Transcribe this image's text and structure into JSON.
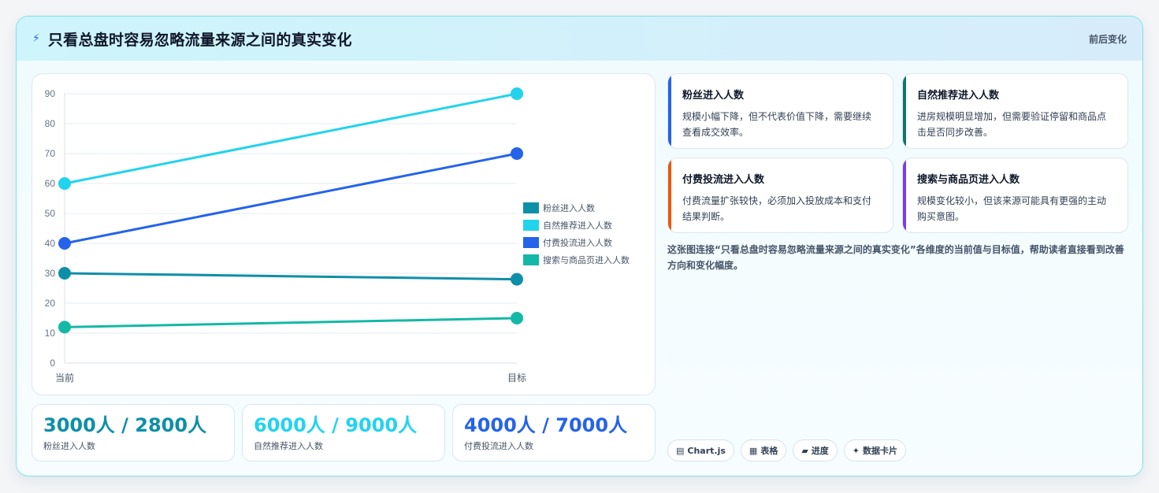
{
  "header": {
    "title": "只看总盘时容易忽略流量来源之间的真实变化",
    "right_label": "前后变化",
    "icon": "bolt-icon"
  },
  "colors": {
    "fans": "#0e8fa8",
    "natural": "#22d3ee",
    "paid": "#2563eb",
    "search": "#14b8a6"
  },
  "chart_data": {
    "type": "line",
    "x": [
      "当前",
      "目标"
    ],
    "series": [
      {
        "name": "粉丝进入人数",
        "values": [
          30,
          28
        ],
        "color": "#0e8fa8"
      },
      {
        "name": "自然推荐进入人数",
        "values": [
          60,
          90
        ],
        "color": "#22d3ee"
      },
      {
        "name": "付费投流进入人数",
        "values": [
          40,
          70
        ],
        "color": "#2563eb"
      },
      {
        "name": "搜索与商品页进入人数",
        "values": [
          12,
          15
        ],
        "color": "#14b8a6"
      }
    ],
    "ylim": [
      0,
      90
    ],
    "yticks": [
      0,
      10,
      20,
      30,
      40,
      50,
      60,
      70,
      80,
      90
    ],
    "grid": true,
    "legend": "right"
  },
  "stats": [
    {
      "value": "3000人 / 2800人",
      "label": "粉丝进入人数",
      "color": "#0e8fa8"
    },
    {
      "value": "6000人 / 9000人",
      "label": "自然推荐进入人数",
      "color": "#22d3ee"
    },
    {
      "value": "4000人 / 7000人",
      "label": "付费投流进入人数",
      "color": "#2563eb"
    }
  ],
  "insights": [
    {
      "title": "粉丝进入人数",
      "text": "规模小幅下降，但不代表价值下降，需要继续查看成交效率。",
      "accent": "#2563eb"
    },
    {
      "title": "自然推荐进入人数",
      "text": "进房规模明显增加，但需要验证停留和商品点击是否同步改善。",
      "accent": "#0f766e"
    },
    {
      "title": "付费投流进入人数",
      "text": "付费流量扩张较快，必须加入投放成本和支付结果判断。",
      "accent": "#ea580c"
    },
    {
      "title": "搜索与商品页进入人数",
      "text": "规模变化较小，但该来源可能具有更强的主动购买意图。",
      "accent": "#7c3aed"
    }
  ],
  "note": "这张图连接“只看总盘时容易忽略流量来源之间的真实变化”各维度的当前值与目标值，帮助读者直接看到改善方向和变化幅度。",
  "tags": [
    {
      "label": "Chart.js",
      "icon": "chart-icon"
    },
    {
      "label": "表格",
      "icon": "table-icon"
    },
    {
      "label": "进度",
      "icon": "progress-icon"
    },
    {
      "label": "数据卡片",
      "icon": "sparkle-icon"
    }
  ]
}
